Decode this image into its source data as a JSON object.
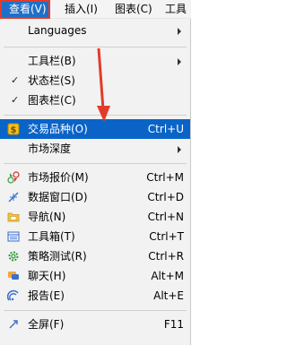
{
  "menubar": {
    "items": [
      {
        "label": "查看(V)"
      },
      {
        "label": "插入(I)"
      },
      {
        "label": "图表(C)"
      },
      {
        "label": "工具"
      }
    ]
  },
  "menu": {
    "languages": {
      "label": "Languages"
    },
    "toolbars": {
      "label": "工具栏(B)"
    },
    "status_bar": {
      "label": "状态栏(S)",
      "checked": true
    },
    "chart_bar": {
      "label": "图表栏(C)",
      "checked": true
    },
    "symbols": {
      "label": "交易品种(O)",
      "shortcut": "Ctrl+U",
      "icon": "dollar-icon"
    },
    "market_depth": {
      "label": "市场深度"
    },
    "market_watch": {
      "label": "市场报价(M)",
      "shortcut": "Ctrl+M",
      "icon": "market-watch-icon"
    },
    "data_window": {
      "label": "数据窗口(D)",
      "shortcut": "Ctrl+D",
      "icon": "crosshair-icon"
    },
    "navigator": {
      "label": "导航(N)",
      "shortcut": "Ctrl+N",
      "icon": "folder-icon"
    },
    "toolbox": {
      "label": "工具箱(T)",
      "shortcut": "Ctrl+T",
      "icon": "toolbox-icon"
    },
    "strategy_tester": {
      "label": "策略测试(R)",
      "shortcut": "Ctrl+R",
      "icon": "gear-icon"
    },
    "chat": {
      "label": "聊天(H)",
      "shortcut": "Alt+M",
      "icon": "chat-icon"
    },
    "reports": {
      "label": "报告(E)",
      "shortcut": "Alt+E",
      "icon": "report-icon"
    },
    "fullscreen": {
      "label": "全屏(F)",
      "shortcut": "F11",
      "icon": "fullscreen-icon"
    }
  },
  "colors": {
    "highlight": "#0a64c8",
    "menubar_active": "#1f6fc8",
    "annotation_red": "#e23b2b"
  }
}
